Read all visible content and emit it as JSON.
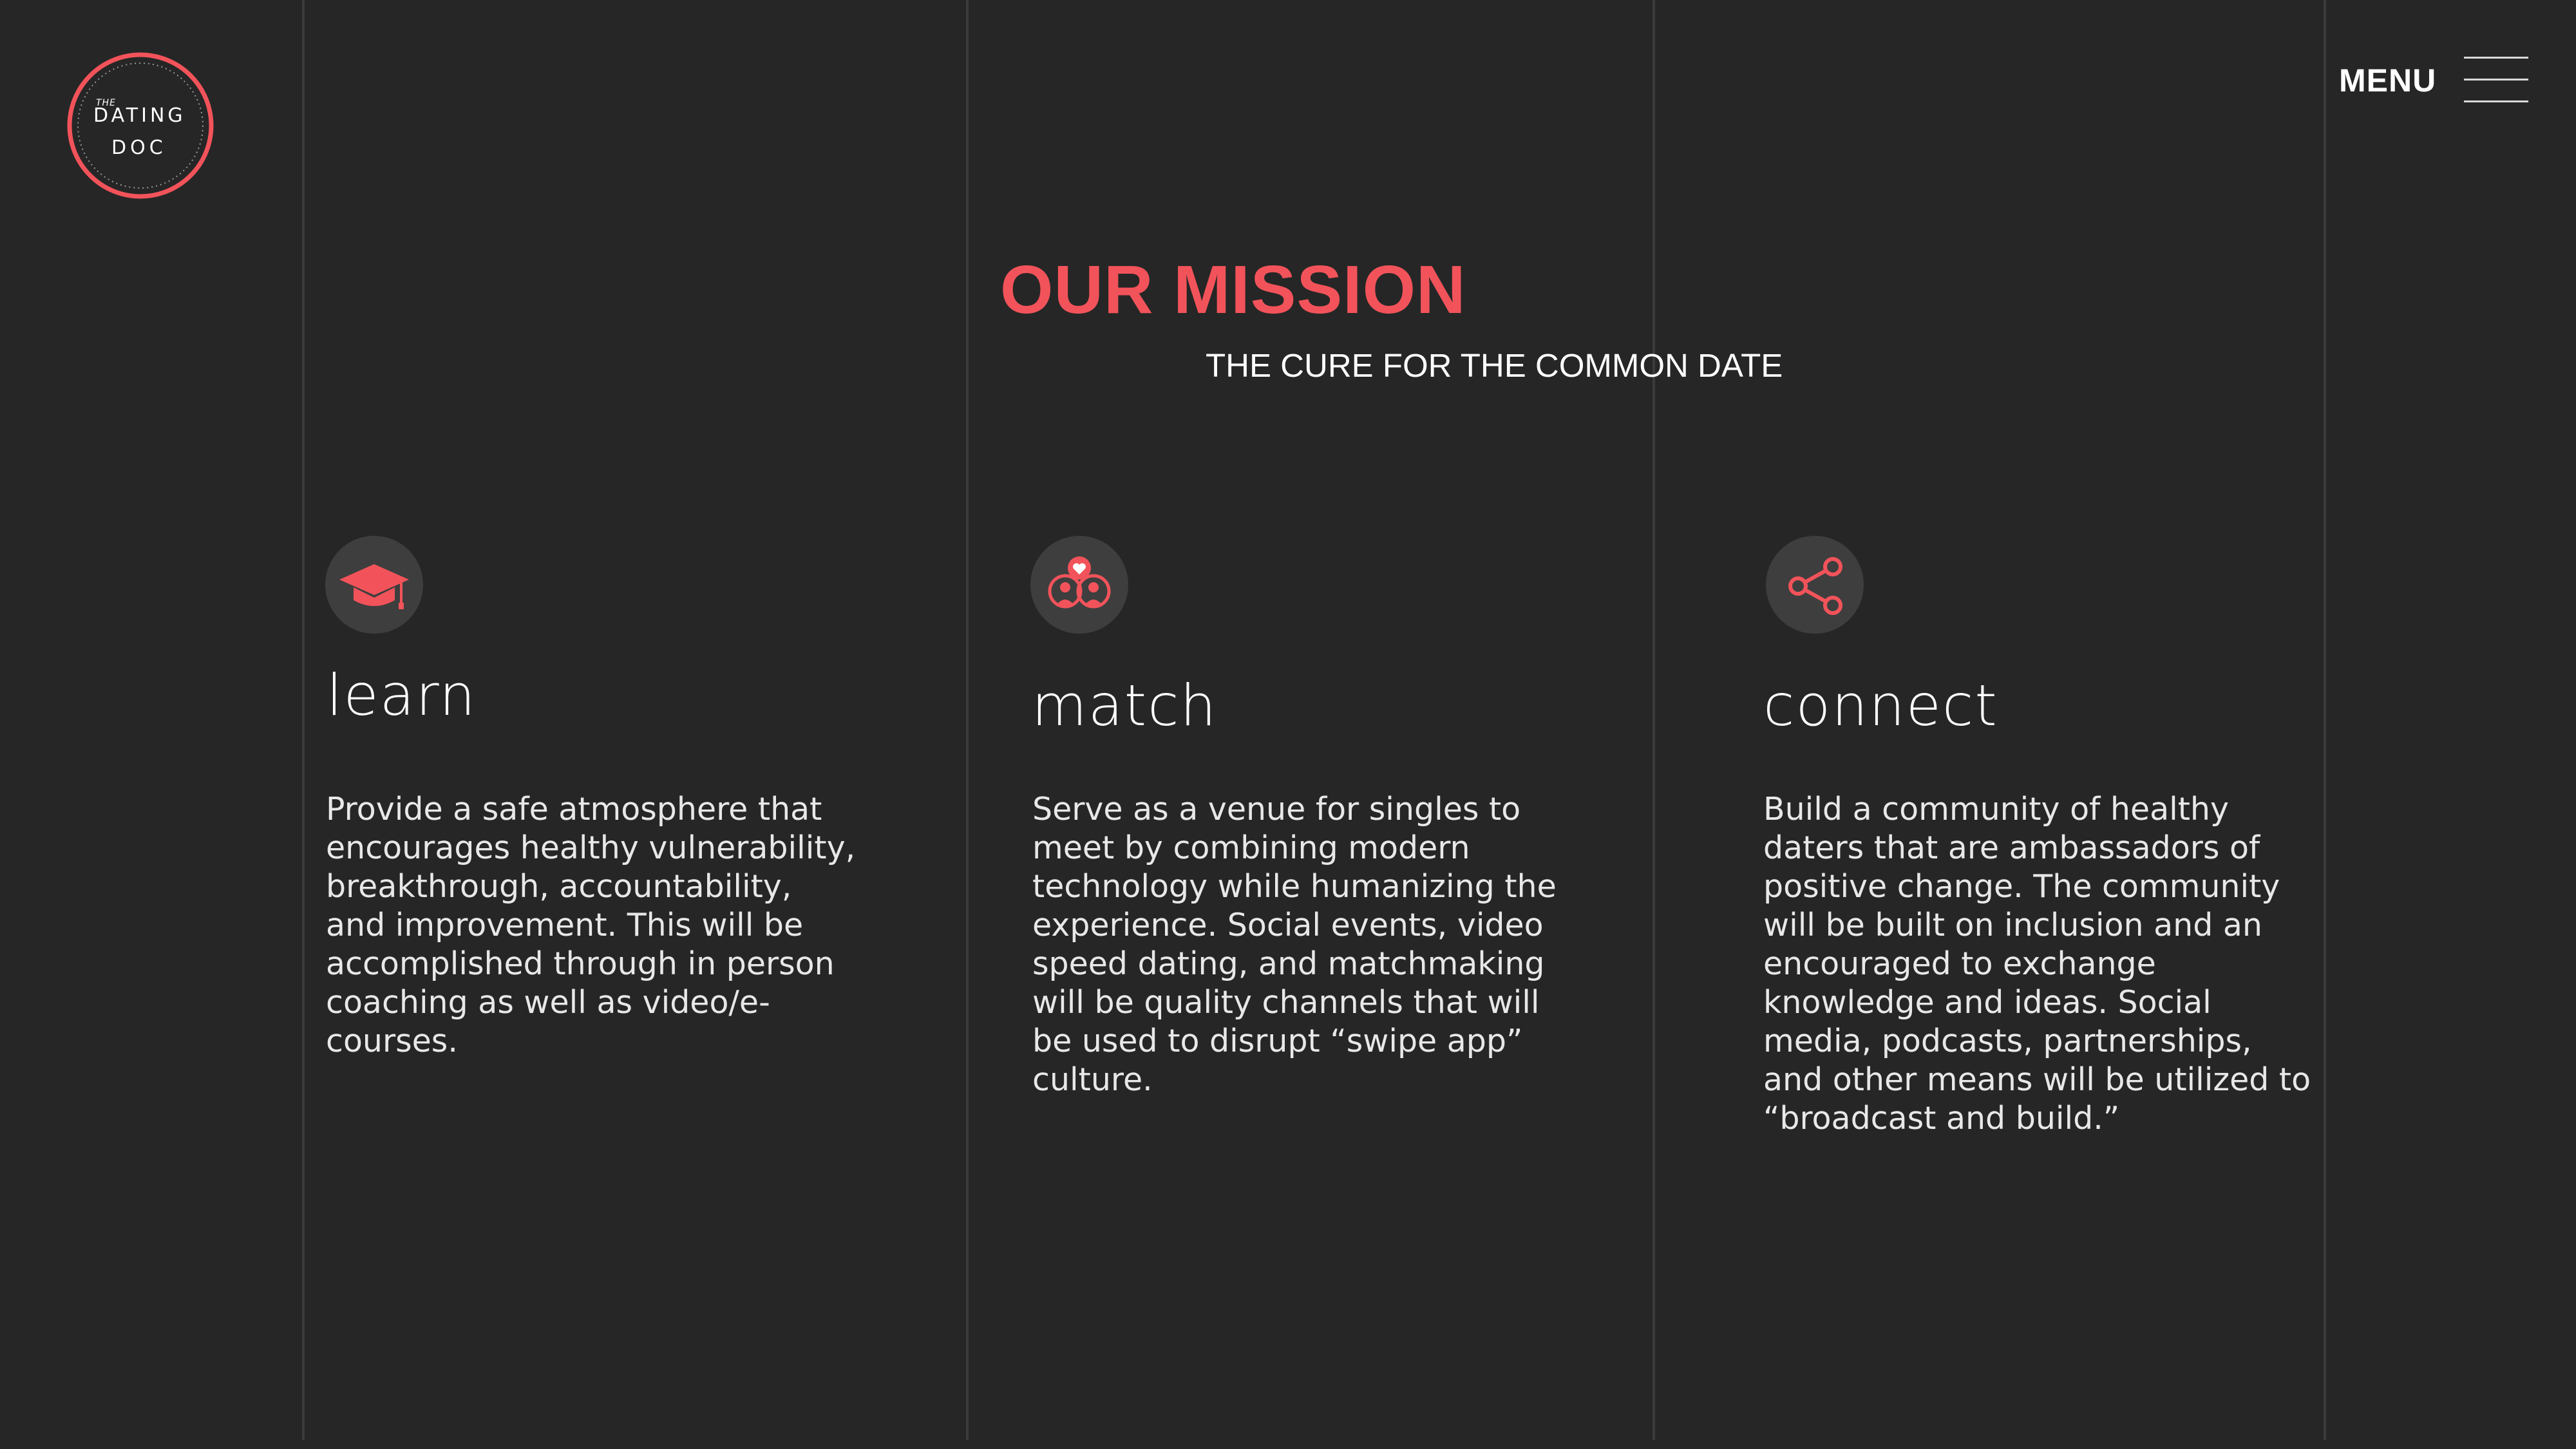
{
  "logo": {
    "the": "THE",
    "dating": "DATING",
    "doc": "DOC"
  },
  "menu": {
    "label": "MENU"
  },
  "mission": {
    "title": "OUR MISSION",
    "subtitle": "THE CURE FOR THE COMMON DATE"
  },
  "features": [
    {
      "title": "learn",
      "icon": "graduation-cap-icon",
      "body": "Provide a safe atmosphere that encourages healthy vulnerability, breakthrough, accountability, and improvement. This will be accomplished through in person coaching as well as video/e-courses."
    },
    {
      "title": "match",
      "icon": "people-heart-icon",
      "body": "Serve as a venue for singles to meet by combining modern technology while humanizing the experience. Social events, video speed dating, and matchmaking will be quality channels that will be used to disrupt “swipe app” culture."
    },
    {
      "title": "connect",
      "icon": "share-icon",
      "body": "Build a community of healthy daters that are ambassadors of positive change. The community will be built on inclusion and an encouraged to exchange knowledge and ideas. Social media, podcasts, partnerships, and other means will be utilized to “broadcast and build.”"
    }
  ],
  "colors": {
    "background": "#262626",
    "accent": "#f2535a",
    "divider": "#3b3b3b",
    "icon_circle": "#3e3e3e"
  }
}
